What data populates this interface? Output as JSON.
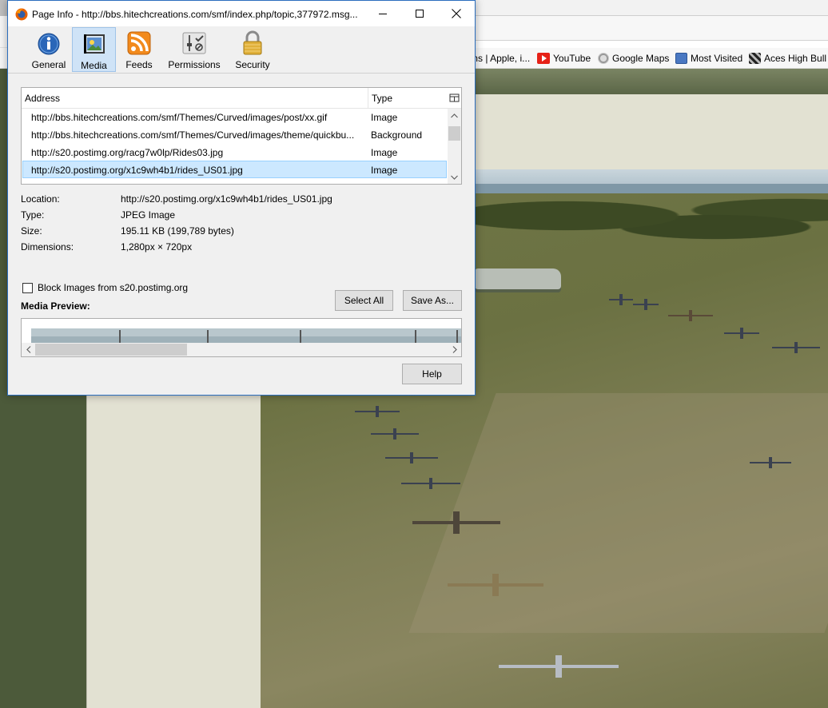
{
  "background": {
    "bookmarks": [
      {
        "label": "ms | Apple, i...",
        "icon": "apple-icon"
      },
      {
        "label": "YouTube",
        "icon": "youtube-icon",
        "color": "#e62117"
      },
      {
        "label": "Google Maps",
        "icon": "globe-icon"
      },
      {
        "label": "Most Visited",
        "icon": "bookmark-folder-icon"
      },
      {
        "label": "Aces High Bull",
        "icon": "aces-high-icon"
      }
    ]
  },
  "dialog": {
    "title": "Page Info - http://bbs.hitechcreations.com/smf/index.php/topic,377972.msg...",
    "tabs": [
      {
        "label": "General",
        "icon": "info-icon",
        "selected": false
      },
      {
        "label": "Media",
        "icon": "media-icon",
        "selected": true
      },
      {
        "label": "Feeds",
        "icon": "rss-feed-icon",
        "selected": false
      },
      {
        "label": "Permissions",
        "icon": "permissions-icon",
        "selected": false
      },
      {
        "label": "Security",
        "icon": "padlock-icon",
        "selected": false
      }
    ],
    "media_list": {
      "columns": {
        "address": "Address",
        "type": "Type"
      },
      "rows": [
        {
          "address": "http://bbs.hitechcreations.com/smf/Themes/Curved/images/post/xx.gif",
          "type": "Image"
        },
        {
          "address": "http://bbs.hitechcreations.com/smf/Themes/Curved/images/theme/quickbu...",
          "type": "Background"
        },
        {
          "address": "http://s20.postimg.org/racg7w0lp/Rides03.jpg",
          "type": "Image"
        },
        {
          "address": "http://s20.postimg.org/x1c9wh4b1/rides_US01.jpg",
          "type": "Image",
          "selected": true
        }
      ]
    },
    "info": {
      "location_label": "Location:",
      "location_value": "http://s20.postimg.org/x1c9wh4b1/rides_US01.jpg",
      "type_label": "Type:",
      "type_value": "JPEG Image",
      "size_label": "Size:",
      "size_value": "195.11 KB (199,789 bytes)",
      "dimensions_label": "Dimensions:",
      "dimensions_value": "1,280px × 720px"
    },
    "block_images_label": "Block Images from s20.postimg.org",
    "block_images_checked": false,
    "select_all_label": "Select All",
    "save_as_label": "Save As...",
    "media_preview_label": "Media Preview:",
    "help_label": "Help",
    "colors": {
      "accent_border": "#2b6ebd",
      "selection": "#cce8ff"
    }
  }
}
